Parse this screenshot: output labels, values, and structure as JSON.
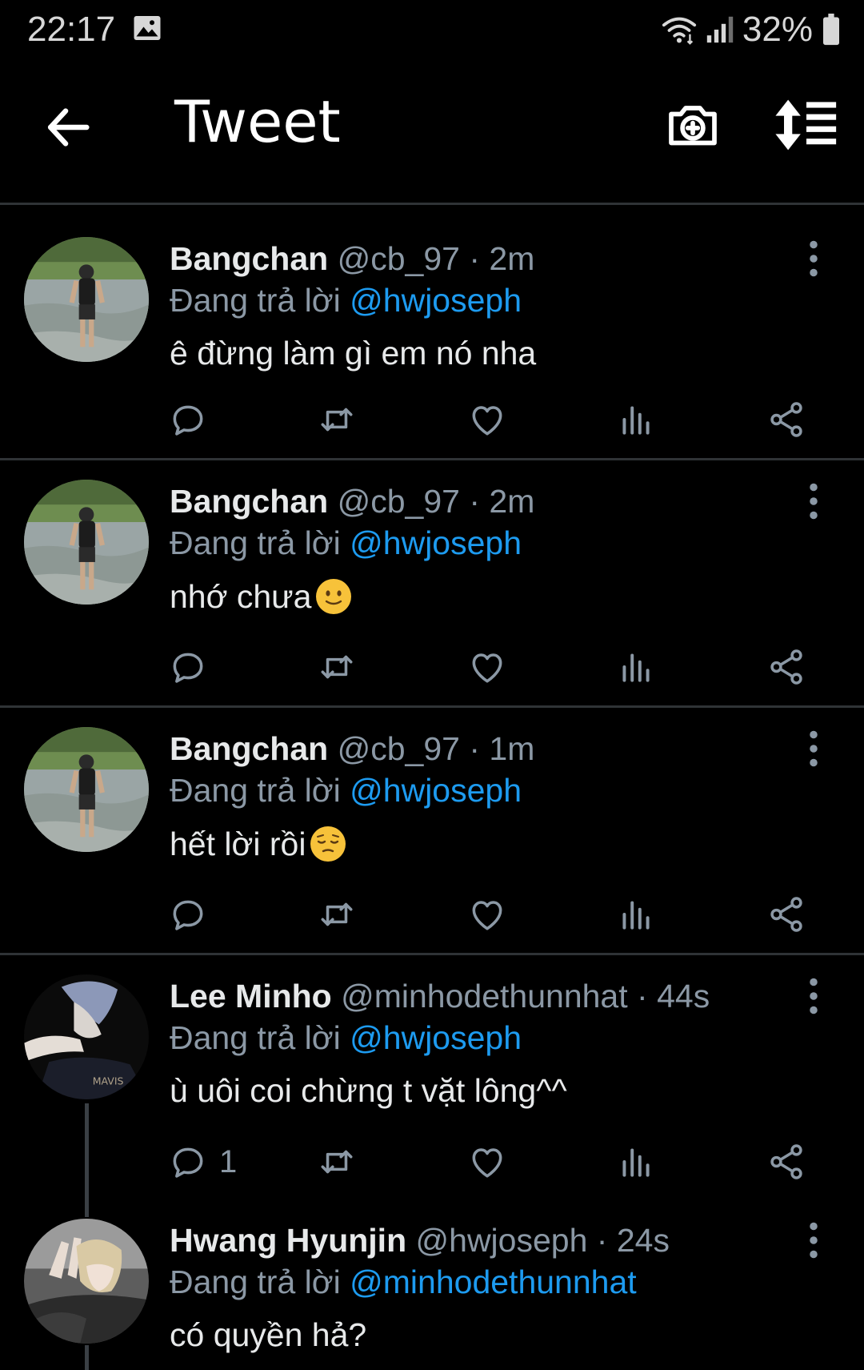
{
  "status_bar": {
    "time": "22:17",
    "battery_percent": "32%",
    "icons": [
      "image-icon",
      "wifi-icon",
      "signal-icon",
      "battery-icon"
    ]
  },
  "header": {
    "title": "Tweet",
    "icons": [
      "back-arrow-icon",
      "camera-add-icon",
      "sort-icon"
    ]
  },
  "tweets": [
    {
      "name": "Bangchan",
      "handle": "@cb_97",
      "separator": "·",
      "time": "2m",
      "replying_prefix": "Đang trả lời",
      "replying_to": "@hwjoseph",
      "text": "ê đừng làm gì em nó nha",
      "emoji": "",
      "reply_count": ""
    },
    {
      "name": "Bangchan",
      "handle": "@cb_97",
      "separator": "·",
      "time": "2m",
      "replying_prefix": "Đang trả lời",
      "replying_to": "@hwjoseph",
      "text": "nhớ chưa",
      "emoji": "slight-smile-emoji",
      "reply_count": ""
    },
    {
      "name": "Bangchan",
      "handle": "@cb_97",
      "separator": "·",
      "time": "1m",
      "replying_prefix": "Đang trả lời",
      "replying_to": "@hwjoseph",
      "text": "hết lời rồi",
      "emoji": "pensive-emoji",
      "reply_count": ""
    },
    {
      "name": "Lee Minho",
      "handle": "@minhodethunnhat",
      "separator": "·",
      "time": "44s",
      "replying_prefix": "Đang trả lời",
      "replying_to": "@hwjoseph",
      "text": "ù uôi coi chừng t vặt lông^^",
      "emoji": "",
      "reply_count": "1"
    },
    {
      "name": "Hwang Hyunjin",
      "handle": "@hwjoseph",
      "separator": "·",
      "time": "24s",
      "replying_prefix": "Đang trả lời",
      "replying_to": "@minhodethunnhat",
      "text": "có quyền hả?",
      "emoji": "",
      "reply_count": ""
    }
  ],
  "colors": {
    "background": "#000000",
    "accent": "#1d9bf0",
    "secondary_text": "#8b98a5",
    "divider": "#2f3336"
  }
}
